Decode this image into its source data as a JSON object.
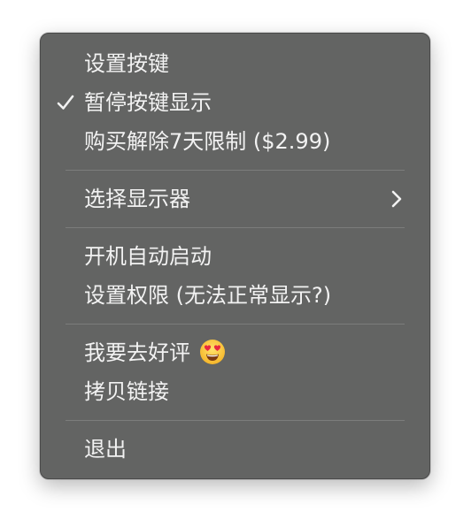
{
  "menu": {
    "items": [
      {
        "label": "设置按键"
      },
      {
        "label": "暂停按键显示",
        "checked": true
      },
      {
        "label": "购买解除7天限制 ($2.99)"
      },
      {
        "label": "选择显示器",
        "submenu": true
      },
      {
        "label": "开机自动启动"
      },
      {
        "label": "设置权限 (无法正常显示?)"
      },
      {
        "label": "我要去好评",
        "trailing_icon": "heart-eyes-emoji-icon"
      },
      {
        "label": "拷贝链接"
      },
      {
        "label": "退出"
      }
    ]
  },
  "icons": {
    "checkmark": "checkmark-icon",
    "submenu": "chevron-right-icon"
  },
  "colors": {
    "menu_background": "#636463",
    "text": "#f2f2f2",
    "separator": "#7c7d7c"
  }
}
